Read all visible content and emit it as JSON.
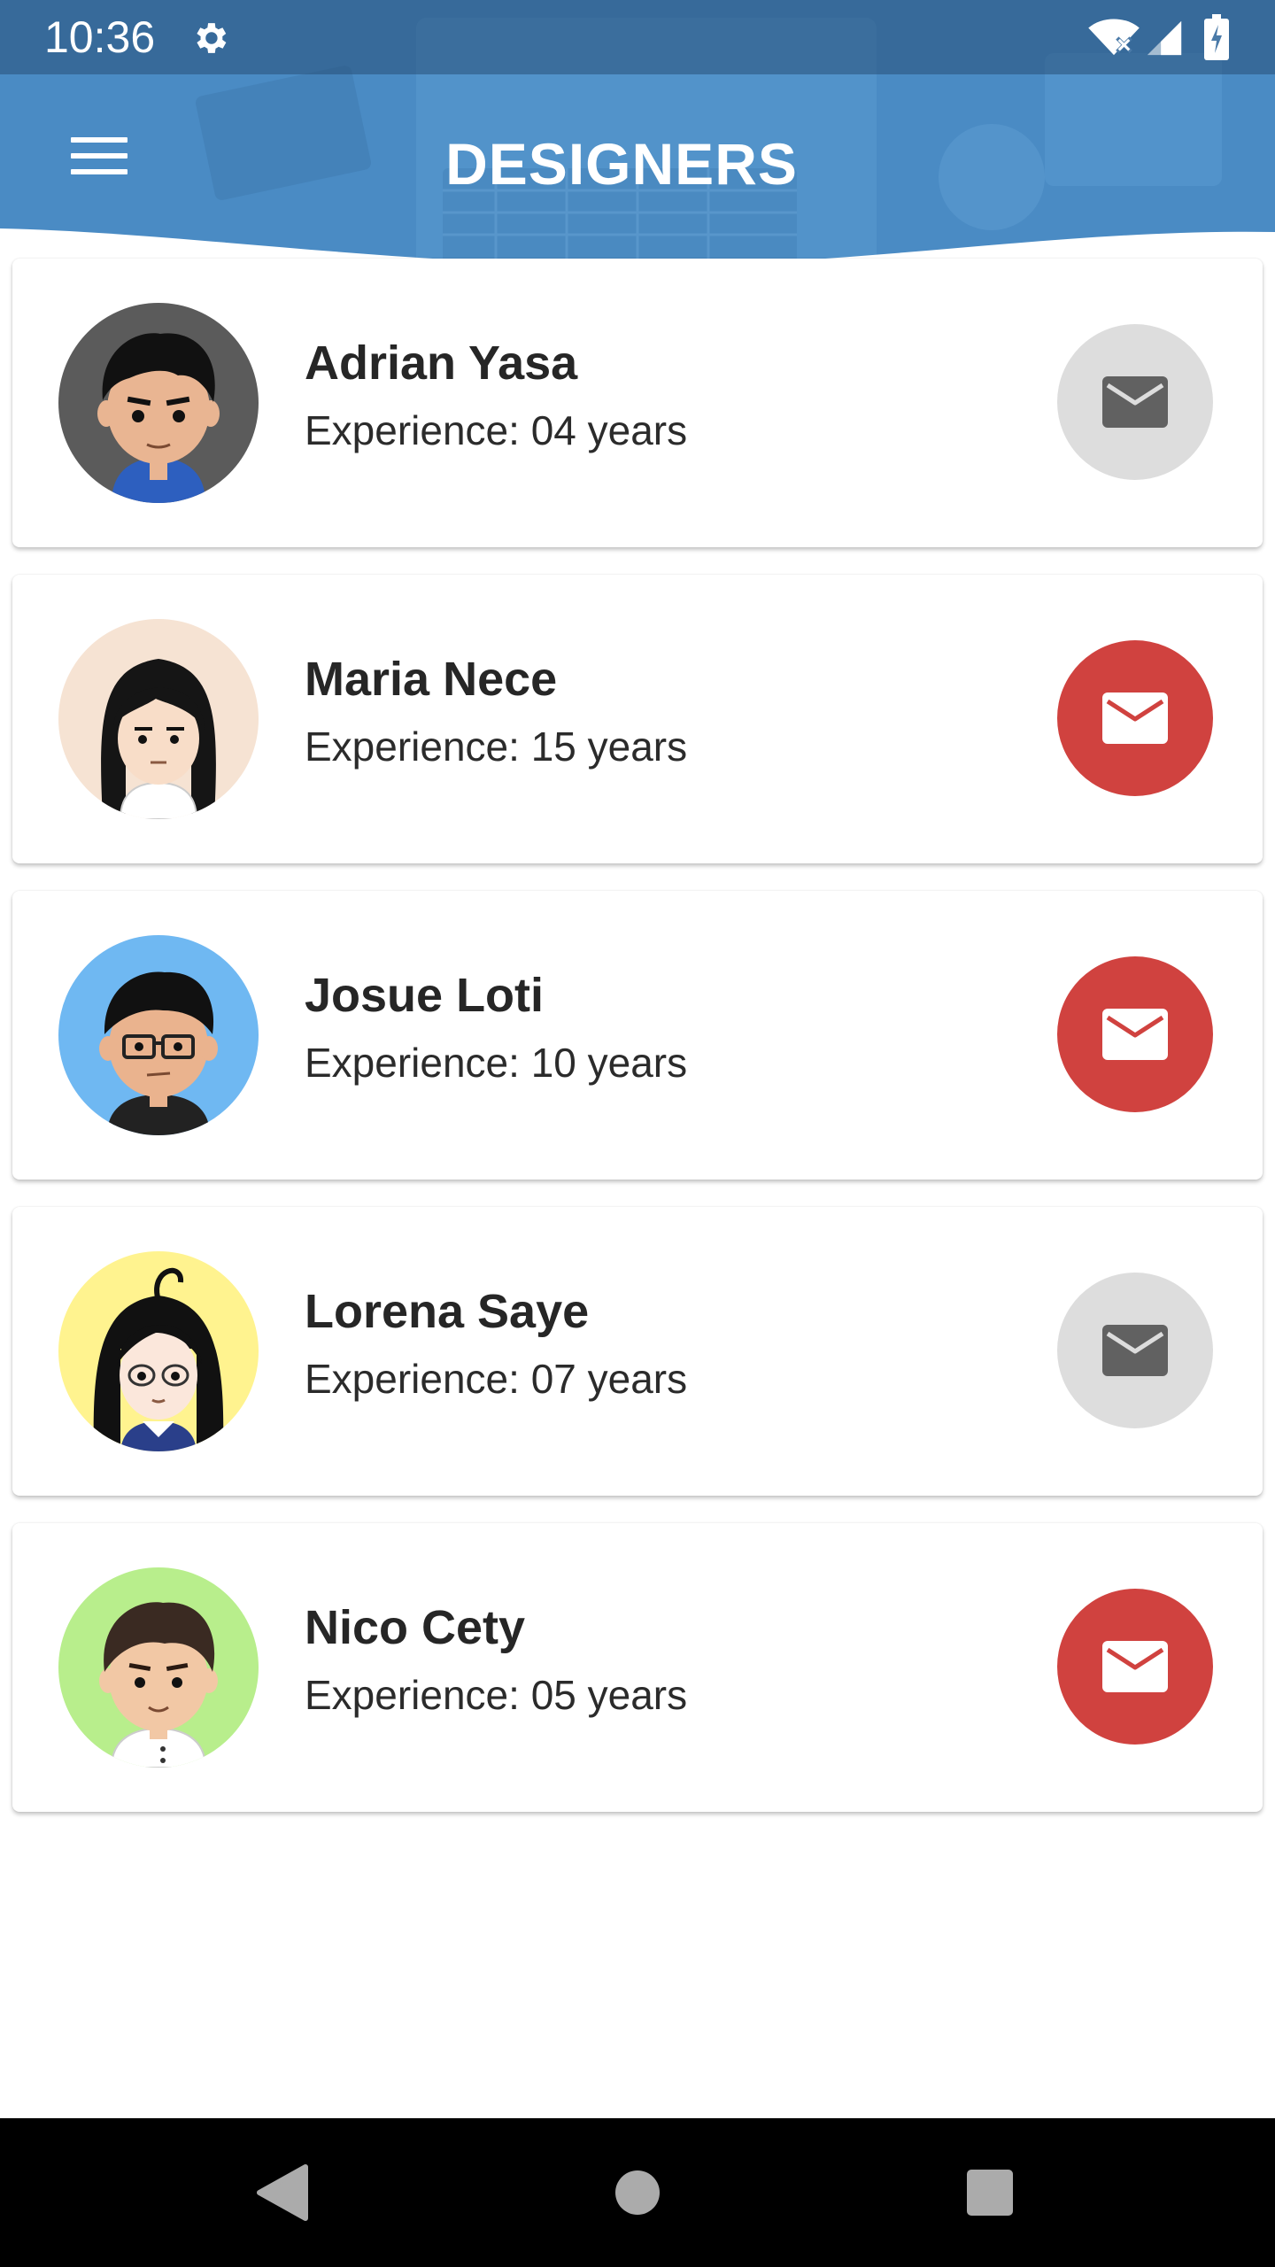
{
  "status_bar": {
    "time": "10:36",
    "icons": [
      "gear-icon",
      "wifi-icon",
      "signal-icon",
      "battery-icon"
    ]
  },
  "header": {
    "title": "DESIGNERS",
    "menu_icon": "hamburger-menu-icon",
    "background_color": "#4a8bc4"
  },
  "designers": [
    {
      "name": "Adrian Yasa",
      "experience": "Experience: 04 years",
      "mail_active": false,
      "avatar_bg": "#5b5b5b"
    },
    {
      "name": "Maria Nece",
      "experience": "Experience: 15 years",
      "mail_active": true,
      "avatar_bg": "#f6e3d3"
    },
    {
      "name": "Josue Loti",
      "experience": "Experience: 10 years",
      "mail_active": true,
      "avatar_bg": "#6fb8f2"
    },
    {
      "name": "Lorena Saye",
      "experience": "Experience: 07 years",
      "mail_active": false,
      "avatar_bg": "#fff38f"
    },
    {
      "name": "Nico Cety",
      "experience": "Experience: 05 years",
      "mail_active": true,
      "avatar_bg": "#b8ee8c"
    }
  ],
  "colors": {
    "mail_active_bg": "#d0423f",
    "mail_inactive_bg": "#dddddd",
    "mail_active_icon": "#ffffff",
    "mail_inactive_icon": "#616161"
  },
  "nav_bar": {
    "buttons": [
      "back-icon",
      "home-icon",
      "recents-icon"
    ]
  }
}
